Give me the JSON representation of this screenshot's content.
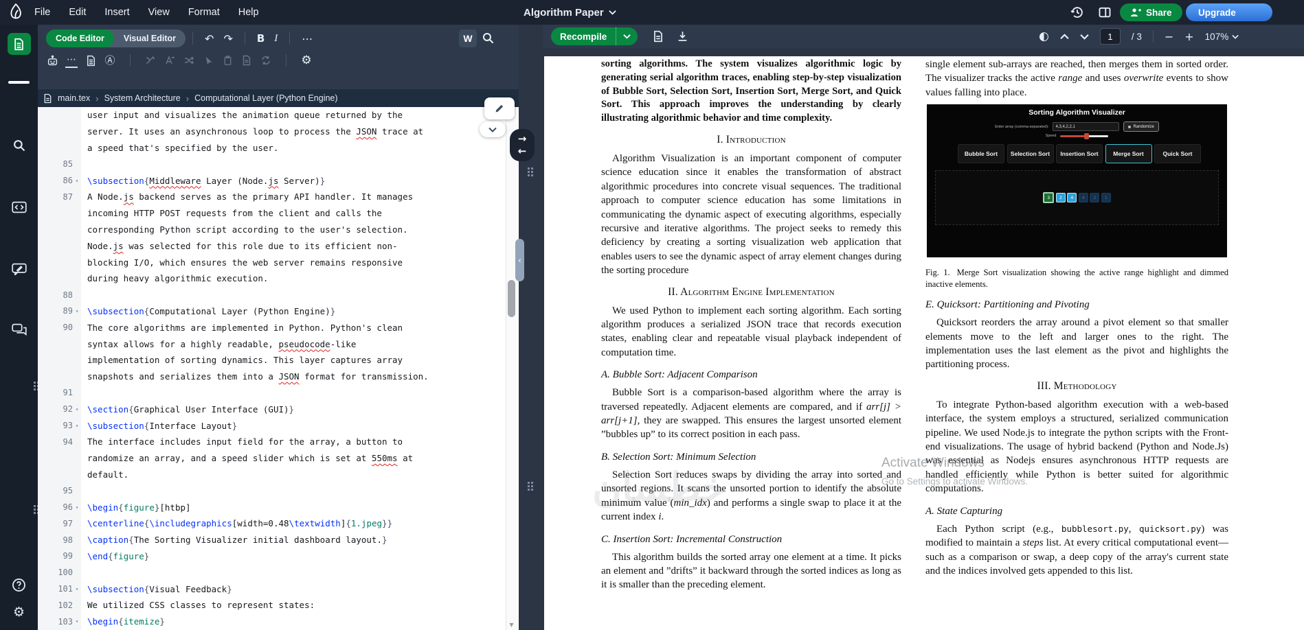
{
  "colors": {
    "accent_green": "#098842",
    "upgrade_blue": "#2d6fd6",
    "command_blue": "#0431fa",
    "env_teal": "#077a66",
    "squiggle_red": "#e02020",
    "header_bg": "#1b2330",
    "toolbar_bg": "#2e3a4c"
  },
  "header": {
    "menus": [
      "File",
      "Edit",
      "Insert",
      "View",
      "Format",
      "Help"
    ],
    "title": "Algorithm Paper",
    "share_label": "Share",
    "upgrade_label": "Upgrade"
  },
  "toolbar": {
    "code_editor": "Code Editor",
    "visual_editor": "Visual Editor",
    "undo": "↶",
    "redo": "↷",
    "bold": "B",
    "italic": "I",
    "more": "⋯",
    "writefull": "W",
    "suggestions": "⋯",
    "language_badge": "Ⓐ",
    "gear": "⚙"
  },
  "breadcrumb": {
    "file": "main.tex",
    "sep": "›",
    "crumbs": [
      "System Architecture",
      "Computational Layer (Python Engine)"
    ]
  },
  "editor": {
    "rows": [
      {
        "n": "",
        "f": false,
        "s": [
          [
            "user input and visualizes the animation queue returned by the",
            "p"
          ]
        ]
      },
      {
        "n": "",
        "f": false,
        "s": [
          [
            "server. It uses an asynchronous loop to process the ",
            "p"
          ],
          [
            "JSON",
            "r"
          ],
          [
            " trace at",
            "p"
          ]
        ]
      },
      {
        "n": "",
        "f": false,
        "s": [
          [
            "a speed that's specified by the user.",
            "p"
          ]
        ]
      },
      {
        "n": "85",
        "f": false,
        "s": []
      },
      {
        "n": "86",
        "f": true,
        "s": [
          [
            "\\subsection",
            "c"
          ],
          [
            "{",
            "b"
          ],
          [
            "Middleware",
            "r"
          ],
          [
            " Layer (Node.",
            "p"
          ],
          [
            "js",
            "r"
          ],
          [
            " Server)",
            "p"
          ],
          [
            "}",
            "b"
          ]
        ]
      },
      {
        "n": "87",
        "f": false,
        "s": [
          [
            "A Node.",
            "p"
          ],
          [
            "js",
            "r"
          ],
          [
            " backend serves as the primary API handler. It manages",
            "p"
          ]
        ]
      },
      {
        "n": "",
        "f": false,
        "s": [
          [
            "incoming HTTP POST requests from the client and calls the",
            "p"
          ]
        ]
      },
      {
        "n": "",
        "f": false,
        "s": [
          [
            "corresponding Python script according to the user's selection.",
            "p"
          ]
        ]
      },
      {
        "n": "",
        "f": false,
        "s": [
          [
            "Node.",
            "p"
          ],
          [
            "js",
            "r"
          ],
          [
            " was selected for this role due to its efficient non-",
            "p"
          ]
        ]
      },
      {
        "n": "",
        "f": false,
        "s": [
          [
            "blocking I/O, which ensures the web server remains responsive",
            "p"
          ]
        ]
      },
      {
        "n": "",
        "f": false,
        "s": [
          [
            "during heavy algorithmic execution.",
            "p"
          ]
        ]
      },
      {
        "n": "88",
        "f": false,
        "s": []
      },
      {
        "n": "89",
        "f": true,
        "s": [
          [
            "\\subsection",
            "c"
          ],
          [
            "{",
            "b"
          ],
          [
            "Computational Layer (Python Engine)",
            "p"
          ],
          [
            "}",
            "b"
          ]
        ]
      },
      {
        "n": "90",
        "f": false,
        "s": [
          [
            "The core algorithms are implemented in Python. Python's clean",
            "p"
          ]
        ]
      },
      {
        "n": "",
        "f": false,
        "s": [
          [
            "syntax allows for a highly readable, ",
            "p"
          ],
          [
            "pseudocode",
            "r"
          ],
          [
            "-like",
            "p"
          ]
        ]
      },
      {
        "n": "",
        "f": false,
        "s": [
          [
            "implementation of sorting dynamics. This layer captures array",
            "p"
          ]
        ]
      },
      {
        "n": "",
        "f": false,
        "s": [
          [
            "snapshots and serializes them into a ",
            "p"
          ],
          [
            "JSON",
            "r"
          ],
          [
            " format for transmission.",
            "p"
          ]
        ]
      },
      {
        "n": "91",
        "f": false,
        "s": []
      },
      {
        "n": "92",
        "f": true,
        "s": [
          [
            "\\section",
            "c"
          ],
          [
            "{",
            "b"
          ],
          [
            "Graphical User Interface (GUI)",
            "p"
          ],
          [
            "}",
            "b"
          ]
        ]
      },
      {
        "n": "93",
        "f": true,
        "s": [
          [
            "\\subsection",
            "c"
          ],
          [
            "{",
            "b"
          ],
          [
            "Interface Layout",
            "p"
          ],
          [
            "}",
            "b"
          ]
        ]
      },
      {
        "n": "94",
        "f": false,
        "s": [
          [
            "The interface includes input field for the array, a button to",
            "p"
          ]
        ]
      },
      {
        "n": "",
        "f": false,
        "s": [
          [
            "randomize an array, and a speed slider which is set at ",
            "p"
          ],
          [
            "550ms",
            "r"
          ],
          [
            " at",
            "p"
          ]
        ]
      },
      {
        "n": "",
        "f": false,
        "s": [
          [
            "default.",
            "p"
          ]
        ]
      },
      {
        "n": "95",
        "f": false,
        "s": []
      },
      {
        "n": "96",
        "f": true,
        "s": [
          [
            "\\begin",
            "c"
          ],
          [
            "{",
            "b"
          ],
          [
            "figure",
            "e"
          ],
          [
            "}",
            "b"
          ],
          [
            "[htbp]",
            "p"
          ]
        ]
      },
      {
        "n": "97",
        "f": false,
        "s": [
          [
            "\\centerline",
            "c"
          ],
          [
            "{",
            "b"
          ],
          [
            "\\includegraphics",
            "c"
          ],
          [
            "[width=0.48",
            "p"
          ],
          [
            "\\textwidth",
            "c"
          ],
          [
            "]",
            "p"
          ],
          [
            "{",
            "b"
          ],
          [
            "1.jpeg",
            "e"
          ],
          [
            "}",
            "b"
          ],
          [
            "}",
            "b"
          ]
        ]
      },
      {
        "n": "98",
        "f": false,
        "s": [
          [
            "\\caption",
            "c"
          ],
          [
            "{",
            "b"
          ],
          [
            "The Sorting Visualizer initial dashboard layout.",
            "p"
          ],
          [
            "}",
            "b"
          ]
        ]
      },
      {
        "n": "99",
        "f": false,
        "s": [
          [
            "\\end",
            "c"
          ],
          [
            "{",
            "b"
          ],
          [
            "figure",
            "e"
          ],
          [
            "}",
            "b"
          ]
        ]
      },
      {
        "n": "100",
        "f": false,
        "s": []
      },
      {
        "n": "101",
        "f": true,
        "s": [
          [
            "\\subsection",
            "c"
          ],
          [
            "{",
            "b"
          ],
          [
            "Visual Feedback",
            "p"
          ],
          [
            "}",
            "b"
          ]
        ]
      },
      {
        "n": "102",
        "f": false,
        "s": [
          [
            "We utilized CSS classes to represent states:",
            "p"
          ]
        ]
      },
      {
        "n": "103",
        "f": true,
        "s": [
          [
            "\\begin",
            "c"
          ],
          [
            "{",
            "b"
          ],
          [
            "itemize",
            "e"
          ],
          [
            "}",
            "b"
          ]
        ]
      }
    ]
  },
  "pdf_toolbar": {
    "recompile": "Recompile",
    "contrast_glyph": "◐",
    "page_current": "1",
    "page_total": "/ 3",
    "minus": "−",
    "plus": "+",
    "zoom": "107%"
  },
  "paper": {
    "col1": [
      {
        "k": "p",
        "b": true,
        "ni": true,
        "seg": [
          [
            "sorting algorithms. The system visualizes algorithmic logic by generating serial algorithm traces, enabling step-by-step visualization of Bubble Sort, Selection Sort, Insertion Sort, Merge Sort, and Quick Sort. This approach improves the understanding by clearly illustrating algorithmic behavior and time complexity.",
            ""
          ]
        ]
      },
      {
        "k": "h",
        "t": "I. Introduction"
      },
      {
        "k": "p",
        "seg": [
          [
            "Algorithm Visualization is an important component of computer science education since it enables the transformation of abstract algorithmic procedures into concrete visual sequences. The traditional approach to computer science education has some limitations in communicating the dynamic aspect of executing algorithms, especially recursive and iterative algorithms. The project seeks to remedy this deficiency by creating a sorting visualization web application that enables users to see the dynamic aspect of array element changes during the sorting procedure",
            ""
          ]
        ]
      },
      {
        "k": "h",
        "t": "II. Algorithm Engine Implementation"
      },
      {
        "k": "p",
        "seg": [
          [
            "We used Python to implement each sorting algorithm. Each sorting algorithm produces a serialized JSON trace that records execution states, enabling clear and repeatable visual playback independent of computation time.",
            ""
          ]
        ]
      },
      {
        "k": "sh",
        "t": "A. Bubble Sort: Adjacent Comparison"
      },
      {
        "k": "p",
        "seg": [
          [
            "Bubble Sort is a comparison-based algorithm where the array is traversed repeatedly. Adjacent elements are compared, and if ",
            ""
          ],
          [
            "arr[j] > arr[j+1]",
            "i"
          ],
          [
            ", they are swapped. This ensures the largest unsorted element ”bubbles up” to its correct position in each pass.",
            ""
          ]
        ]
      },
      {
        "k": "sh",
        "t": "B. Selection Sort: Minimum Selection"
      },
      {
        "k": "p",
        "seg": [
          [
            "Selection Sort reduces swaps by dividing the array into sorted and unsorted regions. It scans the unsorted portion to identify the absolute minimum value (",
            ""
          ],
          [
            "min_idx",
            "i"
          ],
          [
            ") and performs a single swap to place it at the current index ",
            ""
          ],
          [
            "i",
            "i"
          ],
          [
            ".",
            ""
          ]
        ]
      },
      {
        "k": "sh",
        "t": "C. Insertion Sort: Incremental Construction"
      },
      {
        "k": "p",
        "seg": [
          [
            "This algorithm builds the sorted array one element at a time. It picks an element and ”drifts” it backward through the sorted indices as long as it is smaller than the preceding element.",
            ""
          ]
        ]
      }
    ],
    "col2": [
      {
        "k": "p",
        "ni": true,
        "seg": [
          [
            "single element sub-arrays are reached, then merges them in sorted order. The visualizer tracks the active ",
            ""
          ],
          [
            "range",
            "i"
          ],
          [
            " and uses ",
            ""
          ],
          [
            "overwrite",
            "i"
          ],
          [
            " events to show values falling into place.",
            ""
          ]
        ]
      },
      {
        "k": "fig"
      },
      {
        "k": "cap",
        "seg": [
          [
            "Fig. 1.",
            ""
          ],
          [
            "Merge Sort visualization showing the active range highlight and dimmed inactive elements.",
            ""
          ]
        ]
      },
      {
        "k": "sh",
        "t": "E. Quicksort: Partitioning and Pivoting"
      },
      {
        "k": "p",
        "seg": [
          [
            "Quicksort reorders the array around a pivot element so that smaller elements move to the left and larger ones to the right. The implementation uses the last element as the pivot and highlights the partitioning process.",
            ""
          ]
        ]
      },
      {
        "k": "h",
        "t": "III. Methodology"
      },
      {
        "k": "p",
        "seg": [
          [
            "To integrate Python-based algorithm execution with a web-based interface, the system employs a structured, serialized communication pipeline. We used Node.js to integrate the python scripts with the Front-end visualizations. The usage of hybrid backend (Python and Node.Js) was essential as Nodejs ensures asynchronous HTTP requests are handled efficiently while Python is better suited for algorithmic computations.",
            ""
          ]
        ]
      },
      {
        "k": "sh",
        "t": "A. State Capturing"
      },
      {
        "k": "p",
        "seg": [
          [
            "Each Python script (e.g., ",
            ""
          ],
          [
            "bubblesort.py",
            "m"
          ],
          [
            ", ",
            ""
          ],
          [
            "quicksort.py",
            "m"
          ],
          [
            ") was modified to maintain a ",
            ""
          ],
          [
            "steps",
            "i"
          ],
          [
            " list. At every critical computational event—such as a comparison or swap, a deep copy of the array's current state and the indices involved gets appended to this list.",
            ""
          ]
        ]
      }
    ],
    "figure": {
      "title": "Sorting Algorithm Visualizer",
      "array_label": "Enter array (comma-separated):",
      "array_value": "4,3,4,2,2,1",
      "randomize_label": "Randomize",
      "speed_label": "Speed",
      "speed_fraction": 0.53,
      "slider_color": "#c14a38",
      "active_border": "#41c4d8",
      "buttons": [
        "Bubble Sort",
        "Selection Sort",
        "Insertion Sort",
        "Merge Sort",
        "Quick Sort"
      ],
      "active_button": "Merge Sort",
      "cells": [
        {
          "v": "3",
          "state": "green"
        },
        {
          "v": "2",
          "state": "blue"
        },
        {
          "v": "4",
          "state": "blue"
        },
        {
          "v": "4",
          "state": "dim"
        },
        {
          "v": "2",
          "state": "dim"
        },
        {
          "v": "1",
          "state": "dim"
        }
      ]
    },
    "watermark": {
      "line1": "Activate Windows",
      "line2": "Go to Settings to activate Windows."
    },
    "ghost": "خطسان"
  }
}
